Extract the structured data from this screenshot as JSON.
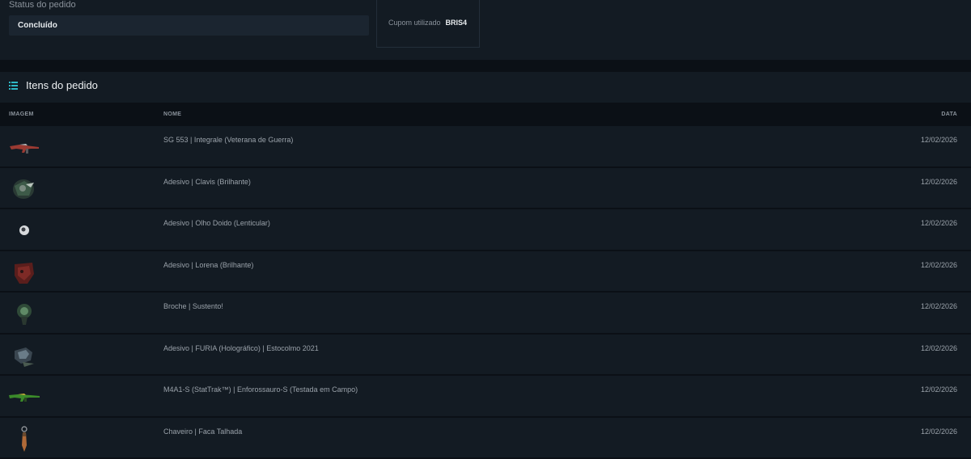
{
  "order": {
    "status_label": "Status do pedido",
    "status_value": "Concluído",
    "coupon_label": "Cupom utilizado",
    "coupon_code": "BRIS4"
  },
  "items": {
    "title": "Itens do pedido",
    "columns": {
      "image": "IMAGEM",
      "name": "NOME",
      "date": "DATA"
    },
    "rows": [
      {
        "name": "SG 553 | Integrale (Veterana de Guerra)",
        "date": "12/02/2026",
        "thumb": "rifle-red"
      },
      {
        "name": "Adesivo | Clavis (Brilhante)",
        "date": "12/02/2026",
        "thumb": "sticker-green"
      },
      {
        "name": "Adesivo | Olho Doido (Lenticular)",
        "date": "12/02/2026",
        "thumb": "sticker-eye"
      },
      {
        "name": "Adesivo | Lorena (Brilhante)",
        "date": "12/02/2026",
        "thumb": "sticker-red"
      },
      {
        "name": "Broche | Sustento!",
        "date": "12/02/2026",
        "thumb": "pin-green"
      },
      {
        "name": "Adesivo | FURIA (Holográfico) | Estocolmo 2021",
        "date": "12/02/2026",
        "thumb": "sticker-furia"
      },
      {
        "name": "M4A1-S (StatTrak™) | Enforossauro-S (Testada em Campo)",
        "date": "12/02/2026",
        "thumb": "rifle-green"
      },
      {
        "name": "Chaveiro | Faca Talhada",
        "date": "12/02/2026",
        "thumb": "keychain-knife"
      }
    ]
  },
  "colors": {
    "background": "#0b1016",
    "panel": "#131b23",
    "accent": "#2fb8c6"
  }
}
